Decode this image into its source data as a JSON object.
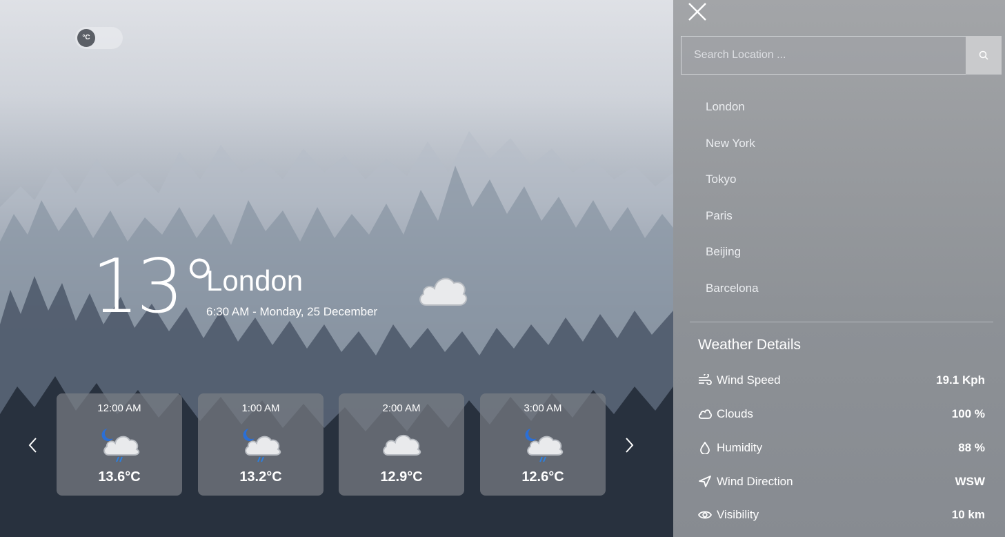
{
  "unit_toggle": {
    "label": "°C"
  },
  "current": {
    "temperature": "13°",
    "city": "London",
    "datetime": "6:30 AM - Monday, 25 December",
    "condition_icon": "cloud-icon"
  },
  "forecast": {
    "prev_icon": "chevron-left-icon",
    "next_icon": "chevron-right-icon",
    "items": [
      {
        "time": "12:00 AM",
        "temp": "13.6°C",
        "icon": "night-rain-cloud-icon"
      },
      {
        "time": "1:00 AM",
        "temp": "13.2°C",
        "icon": "night-rain-cloud-icon"
      },
      {
        "time": "2:00 AM",
        "temp": "12.9°C",
        "icon": "cloud-icon"
      },
      {
        "time": "3:00 AM",
        "temp": "12.6°C",
        "icon": "night-rain-cloud-icon"
      }
    ]
  },
  "panel": {
    "close_icon": "close-icon",
    "search": {
      "placeholder": "Search Location ...",
      "button_icon": "search-icon"
    },
    "locations": [
      "London",
      "New York",
      "Tokyo",
      "Paris",
      "Beijing",
      "Barcelona"
    ],
    "details_title": "Weather Details",
    "details": [
      {
        "label": "Wind Speed",
        "value": "19.1 Kph",
        "icon": "wind-icon"
      },
      {
        "label": "Clouds",
        "value": "100 %",
        "icon": "cloud-outline-icon"
      },
      {
        "label": "Humidity",
        "value": "88 %",
        "icon": "droplet-icon"
      },
      {
        "label": "Wind Direction",
        "value": "WSW",
        "icon": "navigation-arrow-icon"
      },
      {
        "label": "Visibility",
        "value": "10 km",
        "icon": "eye-icon"
      }
    ]
  }
}
